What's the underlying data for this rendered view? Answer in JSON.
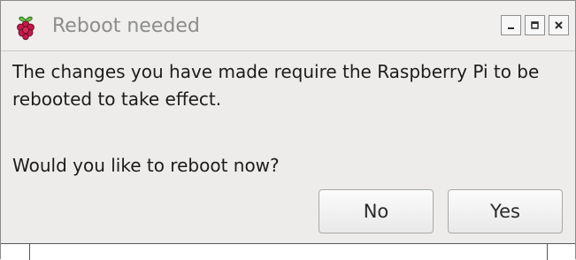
{
  "window": {
    "title": "Reboot needed",
    "icon": "raspberry-icon",
    "controls": [
      "minimize-icon",
      "maximize-icon",
      "close-icon"
    ]
  },
  "dialog": {
    "message": "The changes you have made require the Raspberry Pi to be rebooted to take effect.",
    "question": "Would you like to reboot now?",
    "buttons": {
      "no": "No",
      "yes": "Yes"
    }
  },
  "colors": {
    "raspberry_red": "#c51a4a",
    "leaf_green": "#6cc04a",
    "window_bg": "#edeceb"
  }
}
